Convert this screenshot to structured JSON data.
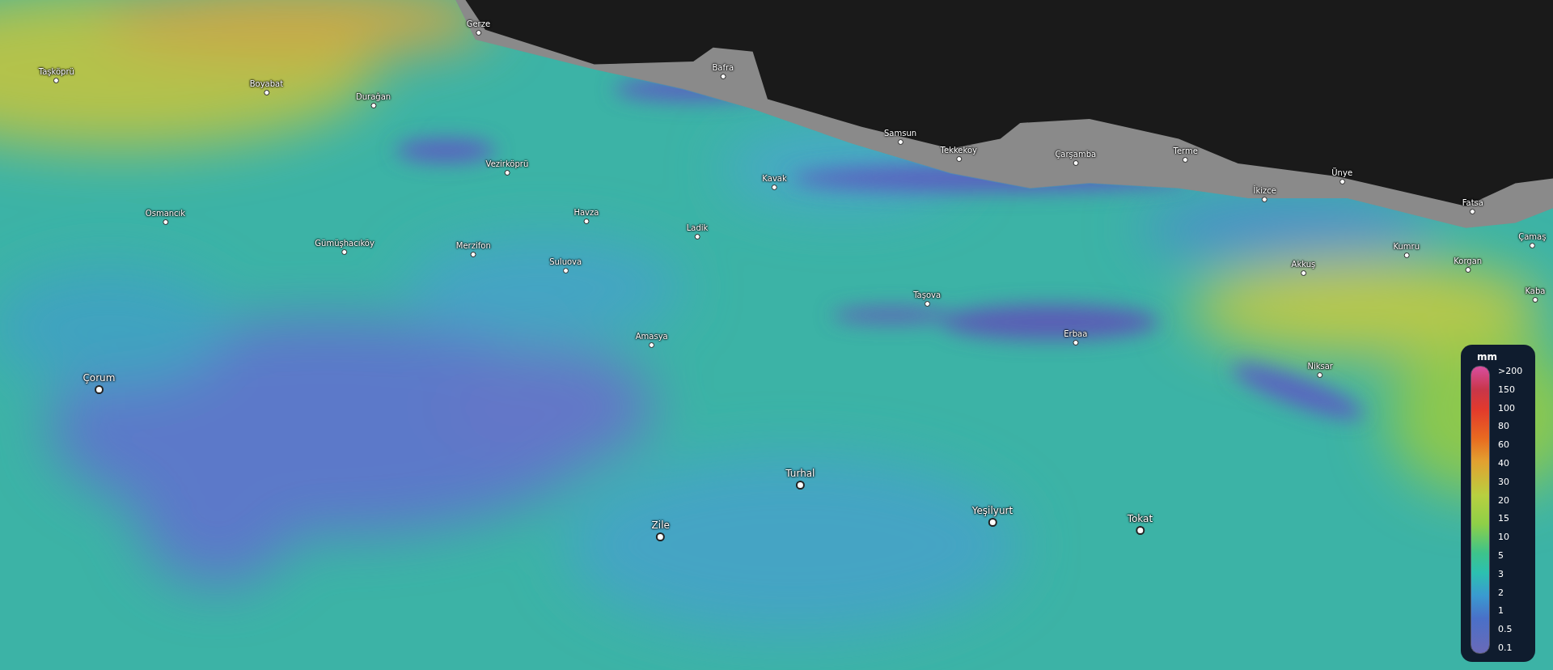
{
  "places": [
    {
      "name": "Gerze",
      "kind": "town"
    },
    {
      "name": "Taşköprü",
      "kind": "town"
    },
    {
      "name": "Boyabat",
      "kind": "town"
    },
    {
      "name": "Durağan",
      "kind": "town"
    },
    {
      "name": "Bafra",
      "kind": "town"
    },
    {
      "name": "Samsun",
      "kind": "town"
    },
    {
      "name": "Tekkeköy",
      "kind": "town"
    },
    {
      "name": "Çarşamba",
      "kind": "town"
    },
    {
      "name": "Terme",
      "kind": "town"
    },
    {
      "name": "Vezirköprü",
      "kind": "town"
    },
    {
      "name": "Ünye",
      "kind": "town"
    },
    {
      "name": "Kavak",
      "kind": "town"
    },
    {
      "name": "İkizce",
      "kind": "town"
    },
    {
      "name": "Fatsa",
      "kind": "town"
    },
    {
      "name": "Osmancık",
      "kind": "town"
    },
    {
      "name": "Havza",
      "kind": "town"
    },
    {
      "name": "Ladik",
      "kind": "town"
    },
    {
      "name": "Çamaş",
      "kind": "town"
    },
    {
      "name": "Gümüşhacıköy",
      "kind": "town"
    },
    {
      "name": "Merzifon",
      "kind": "town"
    },
    {
      "name": "Kumru",
      "kind": "town"
    },
    {
      "name": "Suluova",
      "kind": "town"
    },
    {
      "name": "Korgan",
      "kind": "town"
    },
    {
      "name": "Akkuş",
      "kind": "town"
    },
    {
      "name": "Kaba",
      "kind": "town"
    },
    {
      "name": "Taşova",
      "kind": "town"
    },
    {
      "name": "Erbaa",
      "kind": "town"
    },
    {
      "name": "Amasya",
      "kind": "town"
    },
    {
      "name": "Niksar",
      "kind": "town"
    },
    {
      "name": "Çorum",
      "kind": "city"
    },
    {
      "name": "Turhal",
      "kind": "city"
    },
    {
      "name": "Yeşilyurt",
      "kind": "city"
    },
    {
      "name": "Tokat",
      "kind": "city"
    },
    {
      "name": "Zile",
      "kind": "city"
    }
  ],
  "legend": {
    "unit": "mm",
    "labels": [
      ">200",
      "150",
      "100",
      "80",
      "60",
      "40",
      "30",
      "20",
      "15",
      "10",
      "5",
      "3",
      "2",
      "1",
      "0.5",
      "0.1"
    ]
  }
}
